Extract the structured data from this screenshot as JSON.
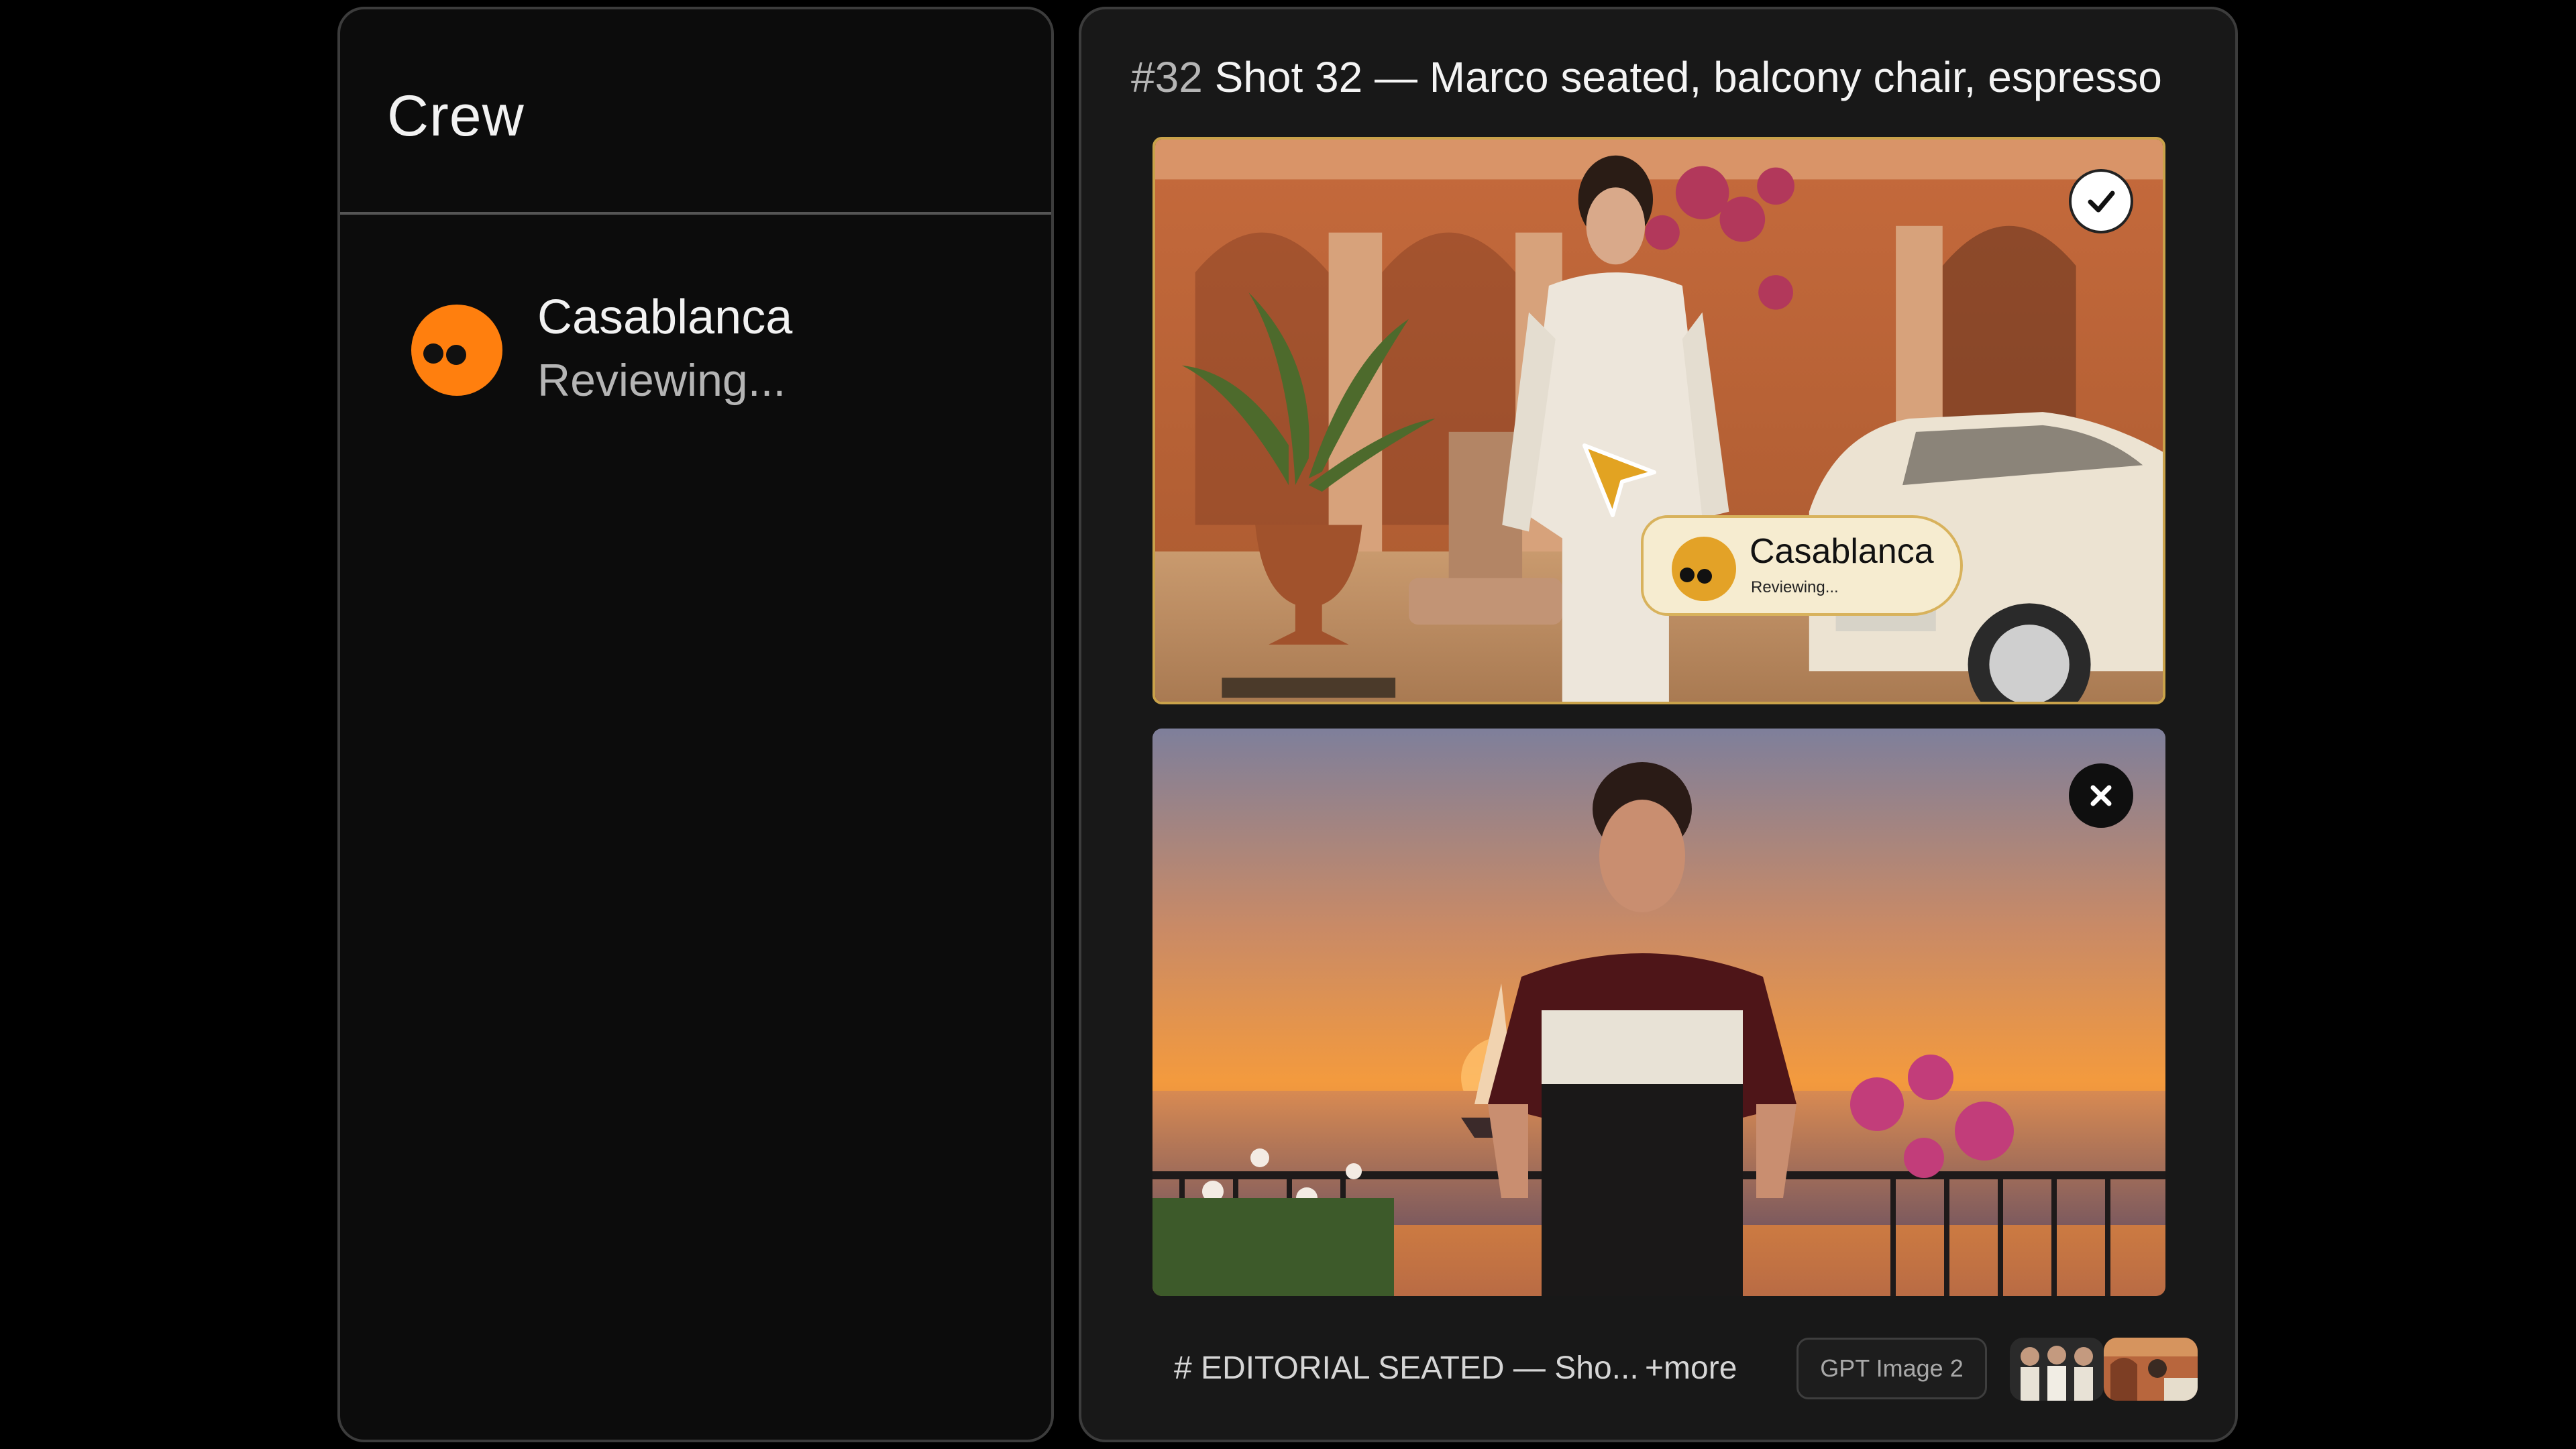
{
  "crew": {
    "title": "Crew",
    "members": [
      {
        "name": "Casablanca",
        "status": "Reviewing...",
        "avatar_color": "#ff7f0e",
        "icon": "orange-avatar-icon"
      }
    ]
  },
  "shot": {
    "number": "#32",
    "title": "Shot 32 — Marco seated, balcony chair, espresso",
    "frames": [
      {
        "id": "frame-1",
        "badge": "check-icon",
        "state": "approved",
        "border_color": "#c9a24a"
      },
      {
        "id": "frame-2",
        "badge": "close-icon",
        "state": "rejected"
      }
    ],
    "hover_card": {
      "name": "Casablanca",
      "status": "Reviewing...",
      "avatar_color": "#e3a227",
      "icon": "cursor-pointer-icon"
    }
  },
  "footer": {
    "tag": "# EDITORIAL SEATED — Sho...",
    "more": "+more",
    "model": "GPT Image 2"
  },
  "colors": {
    "background": "#000000",
    "panel": "#0c0c0c",
    "panel_border": "#3c3c3c",
    "accent": "#ff7f0e",
    "gold": "#c9a24a"
  }
}
